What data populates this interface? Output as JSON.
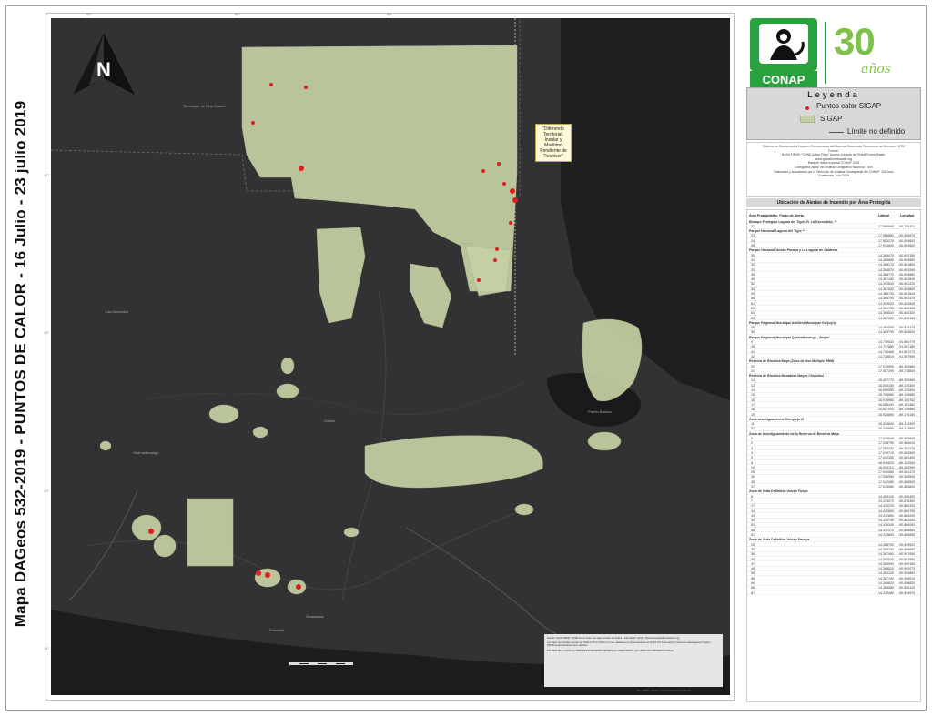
{
  "vertical_title": "Mapa DAGeos 532-2019 - PUNTOS DE CALOR - 16 Julio - 23 julio 2019",
  "map": {
    "north_letter": "N",
    "callout": "\"Diferendo Territorial, Insular y Marítimo Pendiente de Resolver\"",
    "graticule_top": [
      "91°",
      "90°",
      "89°"
    ],
    "graticule_left": [
      "17°",
      "16°",
      "15°",
      "14°"
    ],
    "place_labels": [
      {
        "id": "p1",
        "text": "Tenosique de Pino Suárez"
      },
      {
        "id": "p2",
        "text": "Las Mercedes"
      },
      {
        "id": "p3",
        "text": "Dolores"
      },
      {
        "id": "p4",
        "text": "Guatemala"
      },
      {
        "id": "p5",
        "text": "Cobán"
      },
      {
        "id": "p6",
        "text": "Huehuetenango"
      },
      {
        "id": "p7",
        "text": "Escuintla"
      },
      {
        "id": "p8",
        "text": "Puerto Barrios"
      }
    ]
  },
  "infobox": {
    "line1": "Fuente: NASA FIRMS \"CONE Active Fires\" con base a Datos de Global Forest Watch (2019). http://www.globalforestwatch.org",
    "line2": "Los datos de incendios activos de VIIRS (375 m) NASA e IO son utilizados por los productores de NASA Fire Information for Resource Management System (FIRMS) para identificar focos de calor.",
    "line3": "Los datos de la FIRMS son útiles para la cartografía regional de los fuegos activos, pero deben ser verificados en campo."
  },
  "credit": "Esri, HERE, Garmin, © OpenStreetMap contributors",
  "panel": {
    "logo_text": "CONAP",
    "anniv_number": "30",
    "anniv_word": "años",
    "legend": {
      "title": "Leyenda",
      "items": [
        "Puntos calor SIGAP",
        "SIGAP",
        "Límite no definido"
      ]
    },
    "note_lines": [
      "Sistema de Coordenadas Locales, Coordenadas del Sistema Guatemala Transversa de Mercator / GTM",
      "Fuente:",
      "NASA FIRMS \"CONE Active Fires\" Acceso a través de Global Forest Watch.",
      "www.globalforestwatch.org",
      "Base de datos espacial CONAP 2018",
      "Cartografía digital del Instituto Geográfico Nacional - IGN",
      "Elaborado y actualizado por la Dirección de Análisis Geoespacial del CONAP -DAGeos",
      "Guatemala, Julio 2019"
    ],
    "table_title": "Ubicación de Alertas de Incendio por Área Protegida",
    "table_headers": [
      "Área Protegida/No. Punto de Alerta",
      "Latitud",
      "Longitud"
    ],
    "rows": [
      {
        "g": true,
        "a": "Biotopo Protegido Laguna del Tigre -R. Lo Escondido- **"
      },
      {
        "a": "27",
        "b": "17.580940",
        "c": "-90.795113"
      },
      {
        "g": true,
        "a": "Parque Nacional Laguna del Tigre **"
      },
      {
        "a": "23",
        "b": "17.556860",
        "c": "-90.555970"
      },
      {
        "a": "24",
        "b": "17.553370",
        "c": "-90.554653"
      },
      {
        "a": "38",
        "b": "17.530900",
        "c": "-90.554520"
      },
      {
        "g": true,
        "a": "Parque Nacional Volcán Pacaya y La Laguna de Calderas"
      },
      {
        "a": "30",
        "b": "14.389470",
        "c": "-90.603150"
      },
      {
        "a": "31",
        "b": "14.385880",
        "c": "-90.603850"
      },
      {
        "a": "32",
        "b": "14.388170",
        "c": "-90.601853"
      },
      {
        "a": "33",
        "b": "14.384570",
        "c": "-90.602260"
      },
      {
        "a": "45",
        "b": "14.388770",
        "c": "-90.603880"
      },
      {
        "a": "49",
        "b": "14.387160",
        "c": "-90.602840"
      },
      {
        "a": "52",
        "b": "14.392830",
        "c": "-90.602220"
      },
      {
        "a": "53",
        "b": "14.387530",
        "c": "-90.604890"
      },
      {
        "a": "54",
        "b": "14.386730",
        "c": "-90.601543"
      },
      {
        "a": "56",
        "b": "14.386790",
        "c": "-90.602475"
      },
      {
        "a": "61",
        "b": "14.393000",
        "c": "-90.602840"
      },
      {
        "a": "62",
        "b": "14.391750",
        "c": "-90.600460"
      },
      {
        "a": "63",
        "b": "14.386520",
        "c": "-90.602320"
      },
      {
        "a": "65",
        "b": "14.387080",
        "c": "-90.605153"
      },
      {
        "g": true,
        "a": "Parque Regional Municipal Astillero Municipal Ox'ljuyi'p"
      },
      {
        "a": "55",
        "b": "14.464090",
        "c": "-90.820470"
      },
      {
        "a": "59",
        "b": "14.463790",
        "c": "-90.820633"
      },
      {
        "g": true,
        "a": "Parque Regional Municipal Quetzaltenango - Saqbe'"
      },
      {
        "a": "9",
        "b": "14.739020",
        "c": "-91.564770"
      },
      {
        "a": "28",
        "b": "14.737880",
        "c": "-91.567180"
      },
      {
        "a": "41",
        "b": "14.745460",
        "c": "-91.567272"
      },
      {
        "a": "42",
        "b": "14.738810",
        "c": "-91.567990"
      },
      {
        "g": true,
        "a": "Reserva de Biosfera Maya (Zona de Uso Múltiple RBM)"
      },
      {
        "a": "20",
        "b": "17.039900",
        "c": "-89.369980"
      },
      {
        "a": "21",
        "b": "17.067290",
        "c": "-89.278840"
      },
      {
        "g": true,
        "a": "Reserva de Biosfera Montañas Mayas Chiquibul"
      },
      {
        "a": "12",
        "b": "16.457770",
        "c": "-89.300960"
      },
      {
        "a": "13",
        "b": "16.605150",
        "c": "-89.225300"
      },
      {
        "a": "14",
        "b": "16.699550",
        "c": "-89.225400"
      },
      {
        "a": "15",
        "b": "16.796560",
        "c": "-89.199580"
      },
      {
        "a": "16",
        "b": "16.976960",
        "c": "-89.155762"
      },
      {
        "a": "17",
        "b": "16.826440",
        "c": "-89.181362"
      },
      {
        "a": "18",
        "b": "16.847530",
        "c": "-89.199980"
      },
      {
        "a": "19",
        "b": "16.925890",
        "c": "-89.176150"
      },
      {
        "g": true,
        "a": "Zona amortiguamiento Complejo III"
      },
      {
        "a": "11",
        "b": "16.313600",
        "c": "-89.293300"
      },
      {
        "a": "57",
        "b": "16.346890",
        "c": "-89.413800"
      },
      {
        "g": true,
        "a": "Zona de Amortiguamiento de la Reserva de Biosfera Maya"
      },
      {
        "a": "1",
        "b": "17.043040",
        "c": "-90.583600"
      },
      {
        "a": "2",
        "b": "17.038790",
        "c": "-90.580610"
      },
      {
        "a": "3",
        "b": "17.063430",
        "c": "-90.582270"
      },
      {
        "a": "4",
        "b": "17.039710",
        "c": "-90.583950"
      },
      {
        "a": "5",
        "b": "17.042350",
        "c": "-90.583400"
      },
      {
        "a": "8",
        "b": "16.940620",
        "c": "-89.252000"
      },
      {
        "a": "10",
        "b": "16.934110",
        "c": "-89.382990"
      },
      {
        "a": "25",
        "b": "17.040080",
        "c": "-90.581470"
      },
      {
        "a": "26",
        "b": "17.036950",
        "c": "-90.585540"
      },
      {
        "a": "35",
        "b": "17.042450",
        "c": "-90.580600"
      },
      {
        "a": "37",
        "b": "17.043080",
        "c": "-90.583820"
      },
      {
        "g": true,
        "a": "Zona de Veda Definitiva Volcán Fuego"
      },
      {
        "a": "6",
        "b": "14.463140",
        "c": "-90.836453"
      },
      {
        "a": "7",
        "b": "14.473070",
        "c": "-90.878300"
      },
      {
        "a": "27",
        "b": "14.474220",
        "c": "-90.880330"
      },
      {
        "a": "34",
        "b": "14.470650",
        "c": "-90.880790"
      },
      {
        "a": "43",
        "b": "14.472800",
        "c": "-90.884000"
      },
      {
        "a": "44",
        "b": "14.475740",
        "c": "-90.882053"
      },
      {
        "a": "51",
        "b": "14.476340",
        "c": "-90.886053"
      },
      {
        "a": "58",
        "b": "14.472370",
        "c": "-90.886860"
      },
      {
        "a": "61",
        "b": "14.473890",
        "c": "-90.885650"
      },
      {
        "g": true,
        "a": "Zona de Veda Definitiva Volcán Pacaya"
      },
      {
        "a": "29",
        "b": "14.388750",
        "c": "-90.599922"
      },
      {
        "a": "32",
        "b": "14.385150",
        "c": "-90.599660"
      },
      {
        "a": "36",
        "b": "14.387460",
        "c": "-90.597950"
      },
      {
        "a": "39",
        "b": "14.383040",
        "c": "-90.597980"
      },
      {
        "a": "47",
        "b": "14.385090",
        "c": "-90.599150"
      },
      {
        "a": "48",
        "b": "14.388010",
        "c": "-90.592073"
      },
      {
        "a": "50",
        "b": "14.390120",
        "c": "-90.594863"
      },
      {
        "a": "58",
        "b": "14.387190",
        "c": "-90.598510"
      },
      {
        "a": "64",
        "b": "14.385820",
        "c": "-90.598820"
      },
      {
        "a": "66",
        "b": "14.389080",
        "c": "-90.595120"
      },
      {
        "a": "67",
        "b": "14.379460",
        "c": "-90.594970"
      }
    ]
  }
}
